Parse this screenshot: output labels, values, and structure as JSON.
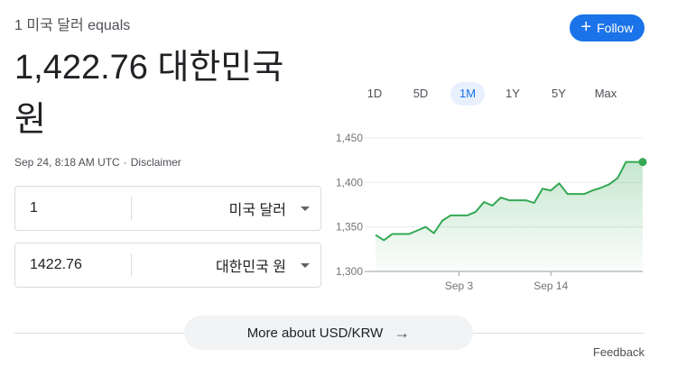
{
  "header": {
    "subtitle": "1 미국 달러 equals",
    "result_value": "1,422.76 대한민국",
    "result_unit": "원",
    "follow_label": "Follow"
  },
  "meta": {
    "timestamp": "Sep 24, 8:18 AM UTC",
    "separator": "·",
    "disclaimer": "Disclaimer"
  },
  "converter": {
    "from_amount": "1",
    "from_currency": "미국 달러",
    "to_amount": "1422.76",
    "to_currency": "대한민국 원"
  },
  "range_tabs": [
    {
      "label": "1D",
      "active": false
    },
    {
      "label": "5D",
      "active": false
    },
    {
      "label": "1M",
      "active": true
    },
    {
      "label": "1Y",
      "active": false
    },
    {
      "label": "5Y",
      "active": false
    },
    {
      "label": "Max",
      "active": false
    }
  ],
  "chart_data": {
    "type": "area",
    "ylim": [
      1300,
      1450
    ],
    "y_ticks": [
      "1,450",
      "1,400",
      "1,350",
      "1,300"
    ],
    "y_tick_values": [
      1450,
      1400,
      1350,
      1300
    ],
    "x_tick_labels": [
      "Sep 3",
      "Sep 14"
    ],
    "x_tick_index": [
      10,
      21
    ],
    "series": [
      {
        "values": [
          1341,
          1335,
          1342,
          1342,
          1342,
          1346,
          1350,
          1343,
          1357,
          1363,
          1363,
          1363,
          1367,
          1378,
          1374,
          1383,
          1380,
          1380,
          1380,
          1377,
          1393,
          1391,
          1399,
          1387,
          1387,
          1387,
          1391,
          1394,
          1398,
          1405,
          1423,
          1423,
          1423
        ]
      }
    ],
    "line_color": "#34a853",
    "grid": true
  },
  "footer": {
    "more_label": "More about USD/KRW",
    "arrow": "→",
    "feedback": "Feedback"
  }
}
